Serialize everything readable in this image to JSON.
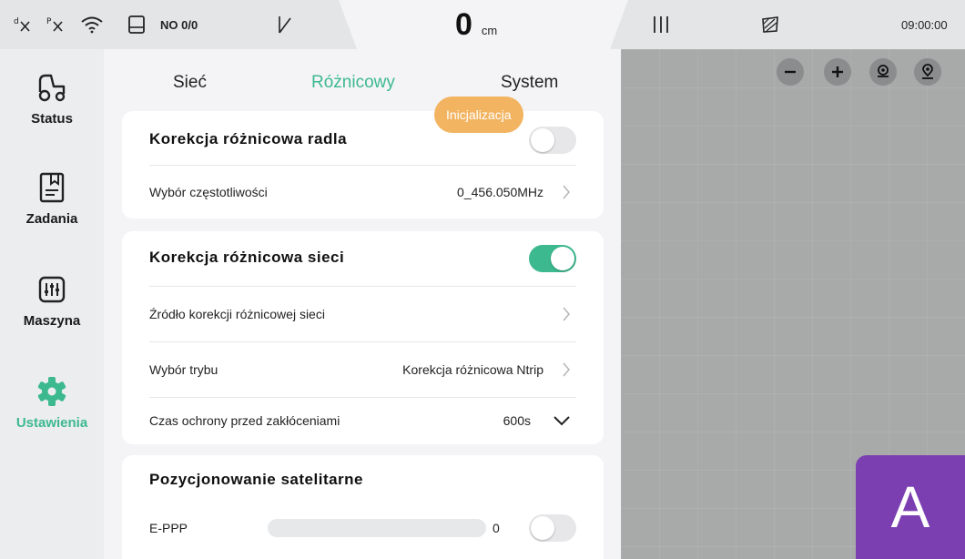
{
  "statusbar": {
    "gnss_label": "NO 0/0",
    "distance_value": "0",
    "distance_unit": "cm",
    "time": "09:00:00"
  },
  "sidebar": {
    "items": [
      {
        "label": "Status",
        "icon": "tractor-icon"
      },
      {
        "label": "Zadania",
        "icon": "task-file-icon"
      },
      {
        "label": "Maszyna",
        "icon": "machine-sliders-icon"
      },
      {
        "label": "Ustawienia",
        "icon": "gear-icon",
        "active": true
      }
    ]
  },
  "tabs": [
    {
      "label": "Sieć"
    },
    {
      "label": "Różnicowy",
      "active": true
    },
    {
      "label": "System"
    }
  ],
  "tooltip": "Inicjalizacja",
  "radio_card": {
    "title": "Korekcja różnicowa radla",
    "toggle_on": false,
    "freq_label": "Wybór częstotliwości",
    "freq_value": "0_456.050MHz"
  },
  "network_card": {
    "title": "Korekcja różnicowa sieci",
    "toggle_on": true,
    "source_label": "Źródło korekcji różnicowej sieci",
    "mode_label": "Wybór trybu",
    "mode_value": "Korekcja różnicowa Ntrip",
    "guard_label": "Czas ochrony przed zakłóceniami",
    "guard_value": "600s"
  },
  "satellite_card": {
    "title": "Pozycjonowanie satelitarne",
    "eppp_label": "E-PPP",
    "eppp_value": "0",
    "eppp_progress": 0,
    "toggle_on": false
  },
  "avatar_letter": "A",
  "colors": {
    "accent": "#3cb98f",
    "tooltip": "#f2b461",
    "avatar": "#7c3fb2"
  }
}
